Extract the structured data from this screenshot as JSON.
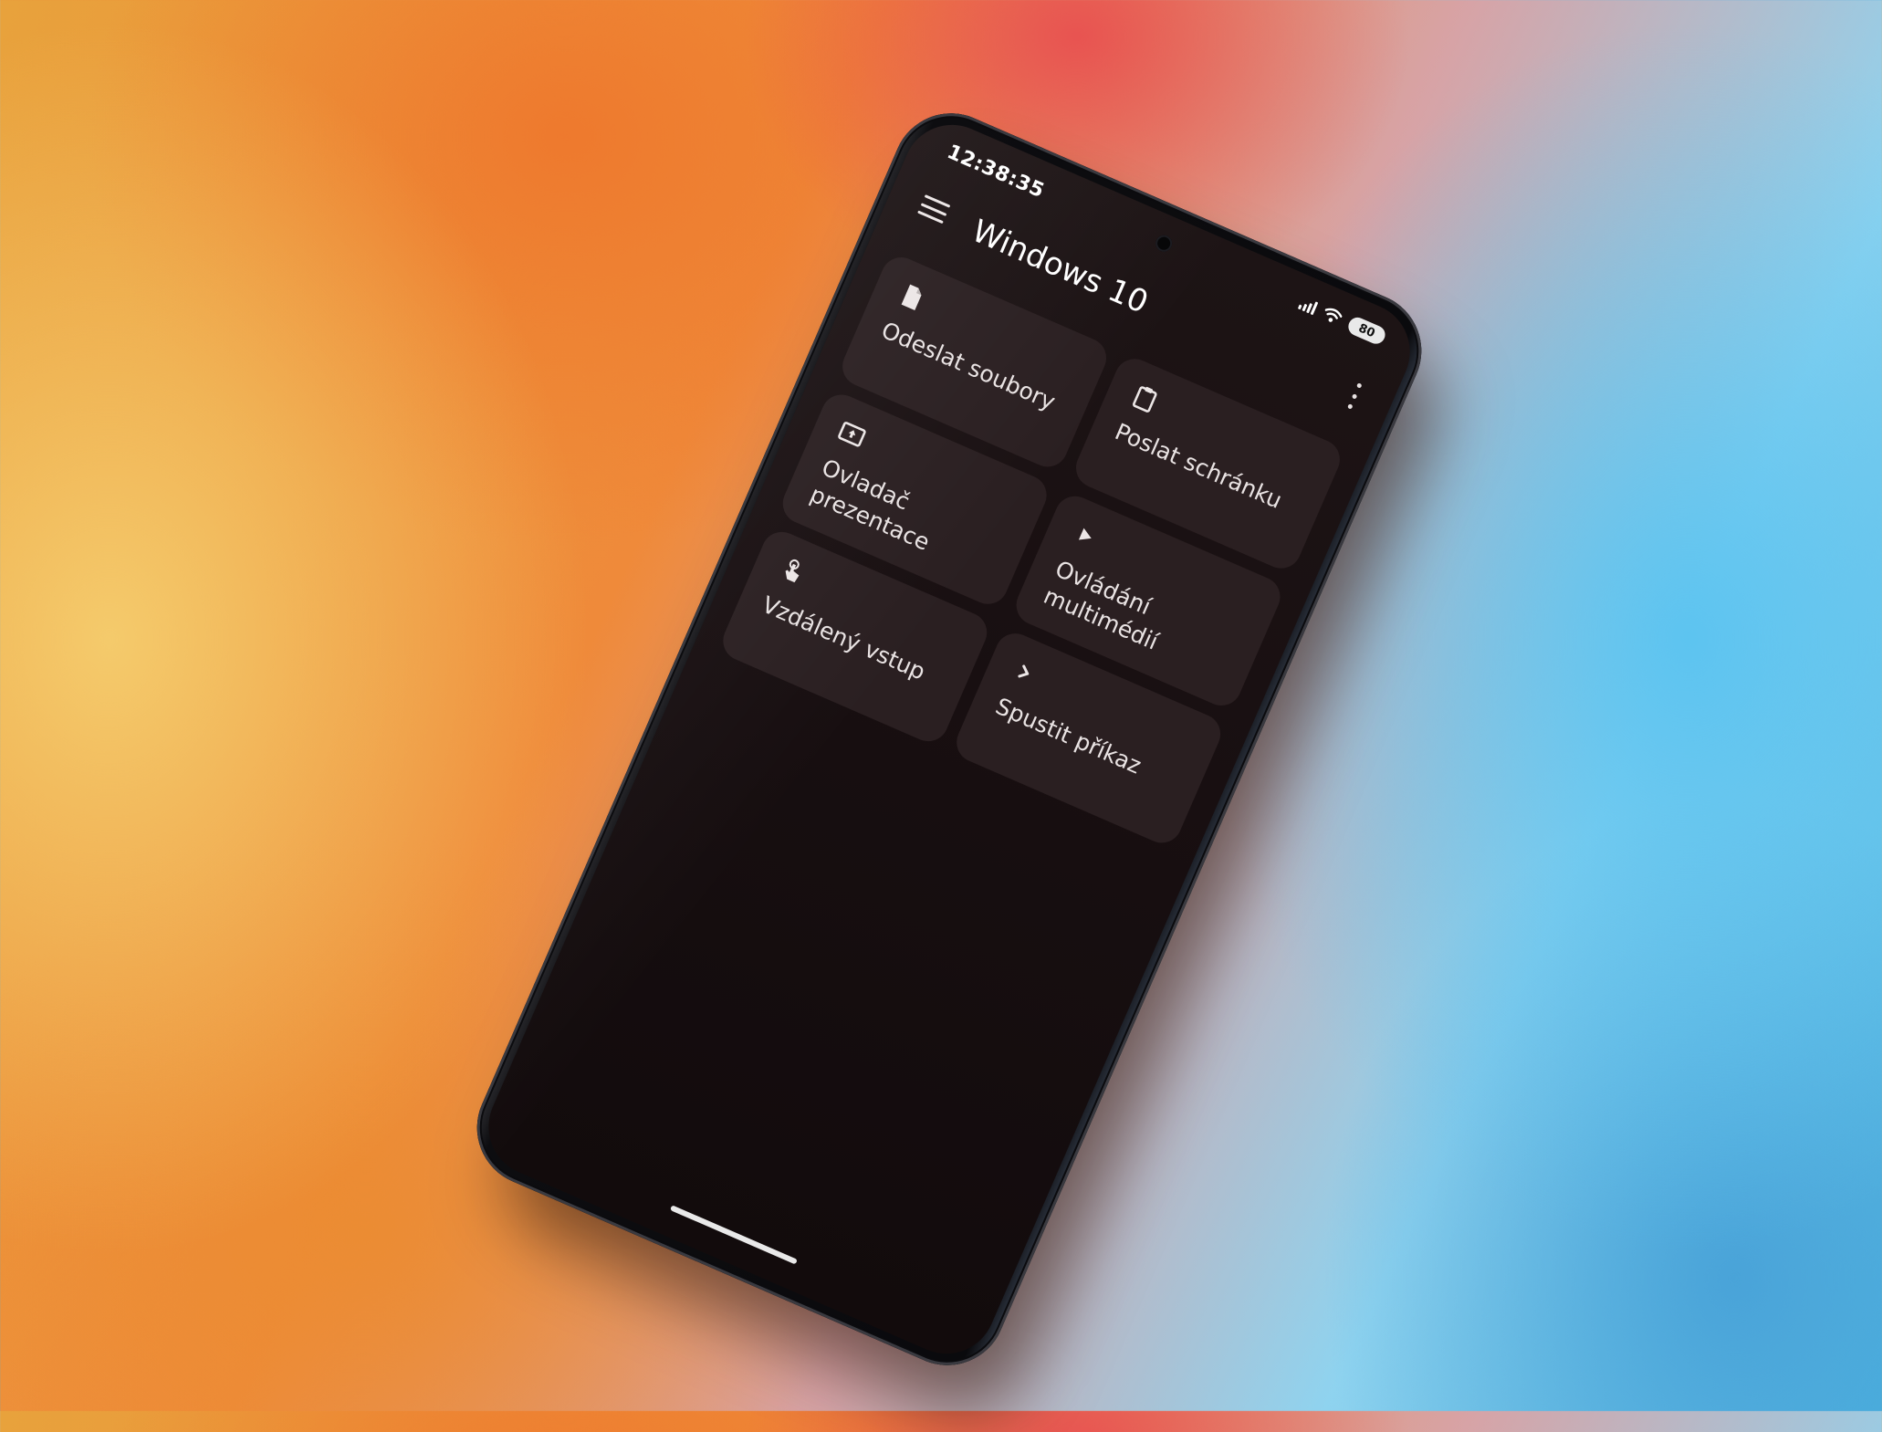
{
  "status_bar": {
    "time": "12:38:35",
    "battery": "80"
  },
  "app_bar": {
    "title": "Windows 10",
    "menu_icon": "hamburger-menu-icon",
    "overflow_icon": "more-vert-icon"
  },
  "tiles": [
    {
      "label": "Odeslat soubory",
      "icon": "file-icon"
    },
    {
      "label": "Poslat schránku",
      "icon": "clipboard-icon"
    },
    {
      "label": "Ovladač\nprezentace",
      "icon": "presentation-icon"
    },
    {
      "label": "Ovládání\nmultimédií",
      "icon": "play-icon"
    },
    {
      "label": "Vzdálený vstup",
      "icon": "touch-icon"
    },
    {
      "label": "Spustit příkaz",
      "icon": "terminal-chevron-icon"
    }
  ],
  "colors": {
    "screen_background": "#180f11",
    "tile_background": "#2a1f21",
    "text": "#e9e3e3"
  }
}
